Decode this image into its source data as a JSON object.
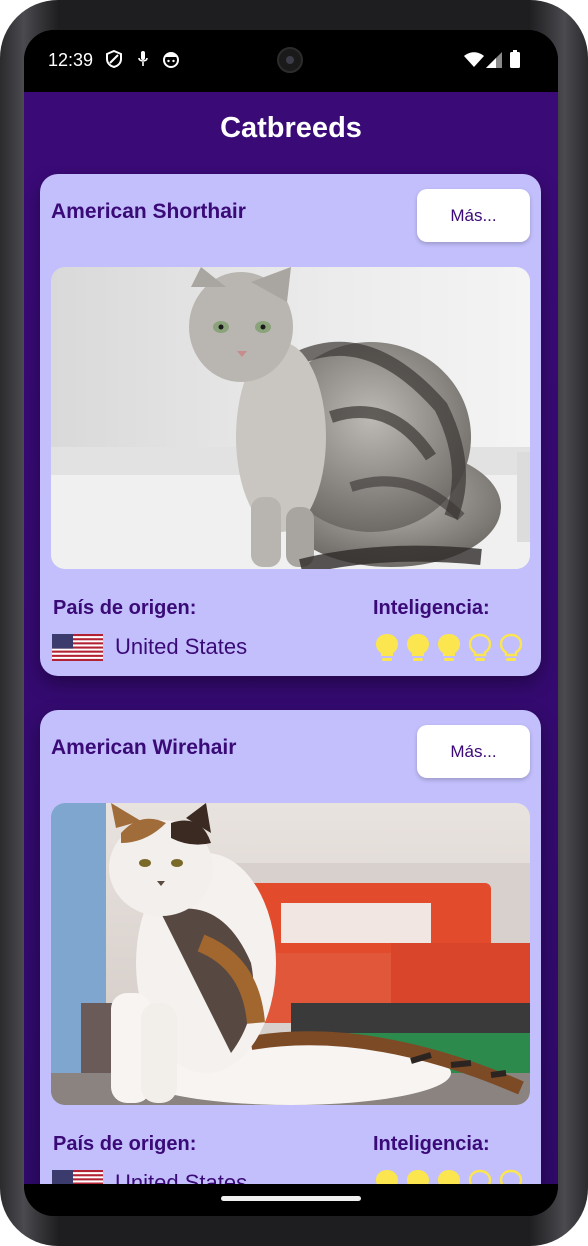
{
  "status_bar": {
    "time": "12:39"
  },
  "app_bar": {
    "title": "Catbreeds"
  },
  "labels": {
    "origin": "País de origen:",
    "intelligence": "Inteligencia:"
  },
  "breeds": [
    {
      "name": "American Shorthair",
      "more_label": "Más...",
      "country": "United States",
      "intelligence": 3,
      "intelligence_max": 5
    },
    {
      "name": "American Wirehair",
      "more_label": "Más...",
      "country": "United States",
      "intelligence": 3,
      "intelligence_max": 5
    }
  ],
  "colors": {
    "primary": "#3a0a77",
    "card": "#c2bffc",
    "bulb_on": "#fbe64f",
    "bulb_off": "#fbe64f"
  }
}
